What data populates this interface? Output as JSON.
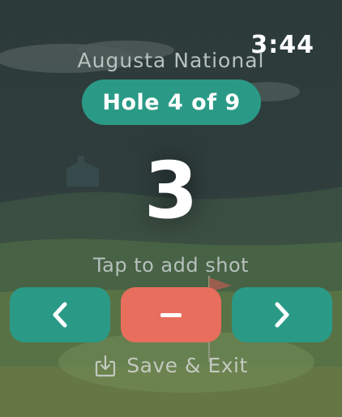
{
  "status": {
    "time": "3:44"
  },
  "course": {
    "name": "Augusta National"
  },
  "hole": {
    "label": "Hole 4 of 9"
  },
  "score": {
    "value": "3"
  },
  "hint": {
    "text": "Tap to add shot"
  },
  "controls": {
    "prev_icon": "chevron-left-icon",
    "minus_icon": "minus-icon",
    "next_icon": "chevron-right-icon"
  },
  "save": {
    "label": "Save & Exit",
    "icon": "download-icon"
  },
  "colors": {
    "accent": "#2a9a86",
    "danger": "#e86e5e",
    "text": "#ffffff",
    "muted": "#b7c1be"
  }
}
